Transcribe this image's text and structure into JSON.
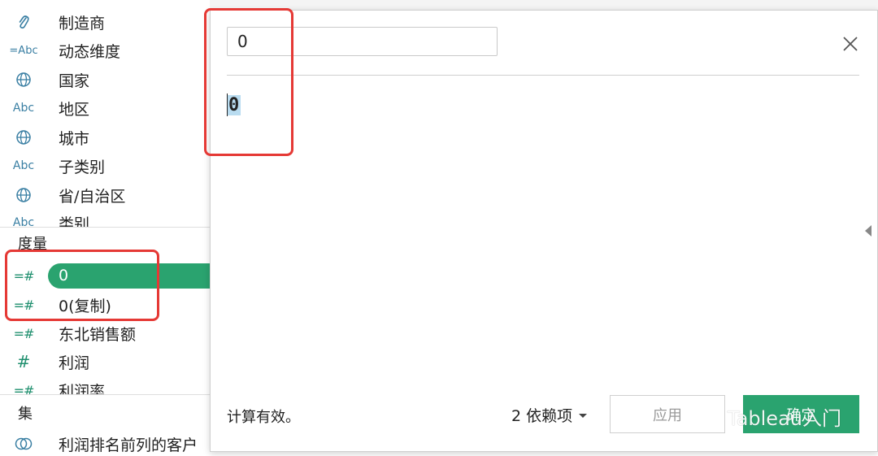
{
  "dimensions": {
    "items": [
      {
        "icon": "paperclip",
        "label": "制造商"
      },
      {
        "icon": "=Abc",
        "label": "动态维度"
      },
      {
        "icon": "globe",
        "label": "国家"
      },
      {
        "icon": "Abc",
        "label": "地区"
      },
      {
        "icon": "globe",
        "label": "城市"
      },
      {
        "icon": "Abc",
        "label": "子类别"
      },
      {
        "icon": "globe",
        "label": "省/自治区"
      },
      {
        "icon": "Abc",
        "label": "类别"
      }
    ]
  },
  "measures": {
    "title": "度量",
    "items": [
      {
        "icon": "=#",
        "label": "0",
        "selected": true
      },
      {
        "icon": "=#",
        "label": "0(复制)"
      },
      {
        "icon": "=#",
        "label": "东北销售额"
      },
      {
        "icon": "#",
        "label": "利润"
      },
      {
        "icon": "=#",
        "label": "利润率"
      }
    ]
  },
  "sets": {
    "title": "集",
    "items": [
      {
        "icon": "set",
        "label": "利润排名前列的客户"
      }
    ]
  },
  "icon_glyphs": {
    "Abc": "Abc",
    "=Abc": "=Abc",
    "#": "#",
    "=#": "=#"
  },
  "dialog": {
    "name_value": "0",
    "formula": "0",
    "status": "计算有效。",
    "dependencies": "2 依赖项",
    "apply_label": "应用",
    "ok_label": "确定"
  },
  "watermark": {
    "text": "Tableau入门"
  },
  "colors": {
    "accent_green": "#2aa36f",
    "annotation_red": "#e53935",
    "abc_blue": "#3a7fa3",
    "measure_green": "#1f8f6e"
  }
}
